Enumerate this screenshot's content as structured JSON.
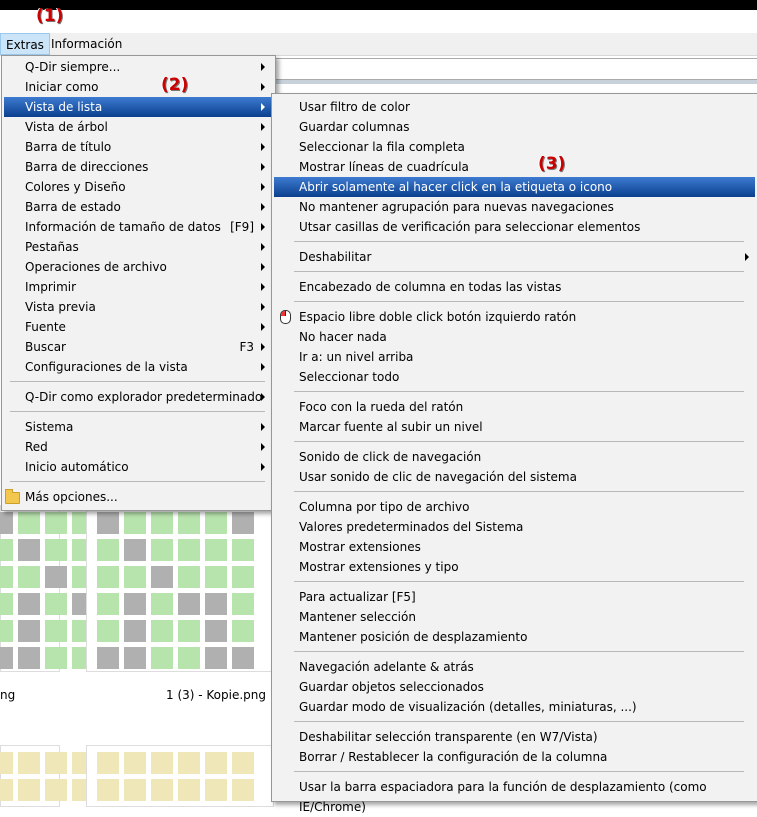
{
  "menubar": {
    "extras": "Extras",
    "informacion": "Información"
  },
  "annotations": [
    "(1)",
    "(2)",
    "(3)"
  ],
  "background": {
    "file_left": "ng",
    "file_right": "1 (3) - Kopie.png"
  },
  "main_menu": [
    {
      "label": "Q-Dir siempre...",
      "arrow": true
    },
    {
      "label": "Iniciar como",
      "arrow": true
    },
    {
      "label": "Vista de lista",
      "arrow": true,
      "highlighted": true
    },
    {
      "label": "Vista de árbol",
      "arrow": true
    },
    {
      "label": "Barra de título",
      "arrow": true
    },
    {
      "label": "Barra de direcciones",
      "arrow": true
    },
    {
      "label": "Colores y Diseño",
      "arrow": true
    },
    {
      "label": "Barra de estado",
      "arrow": true
    },
    {
      "label": "Información de tamaño de datos",
      "shortcut": "[F9]",
      "arrow": true
    },
    {
      "label": "Pestañas",
      "arrow": true
    },
    {
      "label": "Operaciones de archivo",
      "arrow": true
    },
    {
      "label": "Imprimir",
      "arrow": true
    },
    {
      "label": "Vista previa",
      "arrow": true
    },
    {
      "label": "Fuente",
      "arrow": true
    },
    {
      "label": "Buscar",
      "shortcut": "F3",
      "arrow": true
    },
    {
      "label": "Configuraciones de la vista",
      "arrow": true
    },
    {
      "label": "Q-Dir como explorador predeterminado",
      "arrow": true
    },
    {
      "label": "Sistema",
      "arrow": true
    },
    {
      "label": "Red",
      "arrow": true
    },
    {
      "label": "Inicio automático",
      "arrow": true
    },
    {
      "label": "Más opciones...",
      "icon": "folder-icon"
    }
  ],
  "sub_menu": [
    {
      "label": "Usar filtro de color"
    },
    {
      "label": "Guardar columnas"
    },
    {
      "label": "Seleccionar la fila completa"
    },
    {
      "label": "Mostrar líneas de cuadrícula"
    },
    {
      "label": "Abrir solamente al hacer click en la etiqueta o icono",
      "highlighted": true
    },
    {
      "label": "No mantener agrupación para nuevas navegaciones"
    },
    {
      "label": "Utsar casillas de verificación para seleccionar elementos"
    },
    {
      "label": "Deshabilitar",
      "arrow": true
    },
    {
      "label": "Encabezado de columna en todas las vistas"
    },
    {
      "label": "Espacio libre doble click botón izquierdo ratón",
      "icon": "mouse-icon"
    },
    {
      "label": "No hacer nada"
    },
    {
      "label": "Ir a: un nivel arriba"
    },
    {
      "label": "Seleccionar todo"
    },
    {
      "label": "Foco con la rueda del ratón"
    },
    {
      "label": "Marcar fuente al subir un nivel"
    },
    {
      "label": "Sonido de click de navegación"
    },
    {
      "label": "Usar sonido de clic de navegación del sistema"
    },
    {
      "label": "Columna por tipo de archivo"
    },
    {
      "label": "Valores predeterminados del Sistema"
    },
    {
      "label": "Mostrar extensiones"
    },
    {
      "label": "Mostrar extensiones y tipo"
    },
    {
      "label": "Para actualizar [F5]"
    },
    {
      "label": "Mantener selección"
    },
    {
      "label": "Mantener posición de desplazamiento"
    },
    {
      "label": "Navegación adelante & atrás"
    },
    {
      "label": "Guardar objetos seleccionados"
    },
    {
      "label": "Guardar modo de visualización (detalles, miniaturas, ...)"
    },
    {
      "label": "Deshabilitar selección transparente (en W7/Vista)"
    },
    {
      "label": "Borrar / Restablecer la configuración de la columna"
    },
    {
      "label": "Usar la barra espaciadora para la función de desplazamiento (como IE/Chrome)"
    }
  ],
  "colors": {
    "highlight_top": "#3d7bd1",
    "highlight_bottom": "#0b3f8e",
    "annotation": "#cc0000",
    "thumb_green": "#b7e3ad",
    "thumb_gray": "#b0b0b0",
    "thumb_yellow": "#efe7b8"
  }
}
